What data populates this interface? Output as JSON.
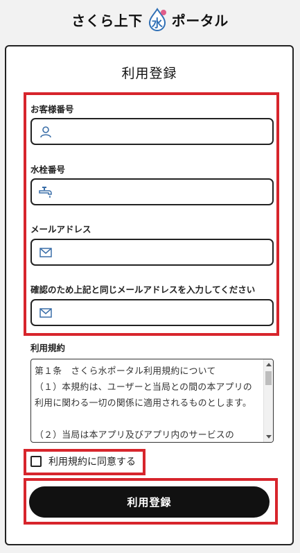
{
  "header": {
    "logo_left": "さくら上下",
    "logo_right": "ポータル",
    "logo_mark_text": "水"
  },
  "form": {
    "title": "利用登録",
    "fields": [
      {
        "label": "お客様番号",
        "icon": "user-icon",
        "value": ""
      },
      {
        "label": "水栓番号",
        "icon": "faucet-icon",
        "value": ""
      },
      {
        "label": "メールアドレス",
        "icon": "mail-icon",
        "value": ""
      },
      {
        "label": "確認のため上記と同じメールアドレスを入力してください",
        "icon": "mail-icon",
        "value": ""
      }
    ],
    "terms_label": "利用規約",
    "terms_text": "第１条　さくら水ポータル利用規約について\n（１）本規約は、ユーザーと当局との間の本アプリの利用に関わる一切の関係に適用されるものとします。\n\n（２）当局は本アプリ及びアプリ内のサービスの",
    "agree_label": "利用規約に同意する",
    "agree_checked": false,
    "submit_label": "利用登録"
  },
  "colors": {
    "highlight": "#d7252c",
    "icon": "#3a6ea8",
    "button": "#111111"
  }
}
